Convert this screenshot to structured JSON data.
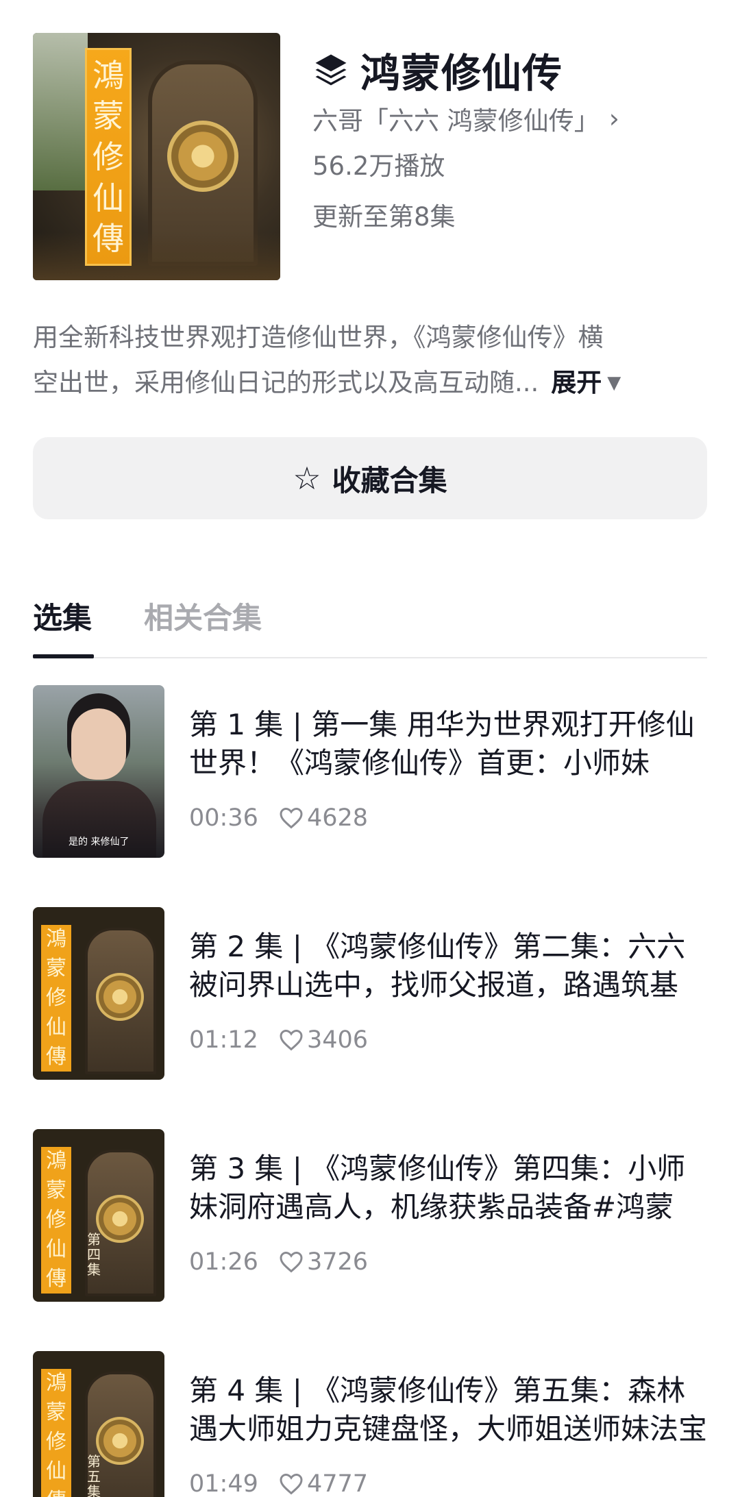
{
  "collection": {
    "title": "鸿蒙修仙传",
    "icon": "layers-icon",
    "author": "六哥「六六 鸿蒙修仙传」",
    "plays": "56.2万播放",
    "updated": "更新至第8集",
    "cover_text": [
      "鴻",
      "蒙",
      "修",
      "仙",
      "傳"
    ]
  },
  "description": {
    "line1": "用全新科技世界观打造修仙世界，《鸿蒙修仙传》横",
    "line2": "空出世，采用修仙日记的形式以及高互动随...",
    "expand_label": "展开"
  },
  "collect_button": {
    "label": "收藏合集",
    "icon": "star-outline-icon"
  },
  "tabs": [
    {
      "label": "选集",
      "active": true
    },
    {
      "label": "相关合集",
      "active": false
    }
  ],
  "episodes": [
    {
      "title": "第 1 集 | 第一集  用华为世界观打开修仙世界！《鸿蒙修仙传》首更：小师妹",
      "duration": "00:36",
      "likes": "4628",
      "thumb_subtitle": "是的 来修仙了"
    },
    {
      "title": "第 2 集 | 《鸿蒙修仙传》第二集：六六被问界山选中，找师父报道，路遇筑基",
      "duration": "01:12",
      "likes": "3406"
    },
    {
      "title": "第 3 集 | 《鸿蒙修仙传》第四集：小师妹洞府遇高人，机缘获紫品装备#鸿蒙",
      "duration": "01:26",
      "likes": "3726",
      "thumb_tag": "第四集"
    },
    {
      "title": "第 4 集 | 《鸿蒙修仙传》第五集：森林遇大师姐力克键盘怪，大师姐送师妹法宝",
      "duration": "01:49",
      "likes": "4777",
      "thumb_tag": "第五集"
    }
  ],
  "colors": {
    "text_primary": "#161823",
    "text_secondary": "#6f7178",
    "button_bg": "#f1f1f2",
    "banner": "#f0a21a"
  }
}
